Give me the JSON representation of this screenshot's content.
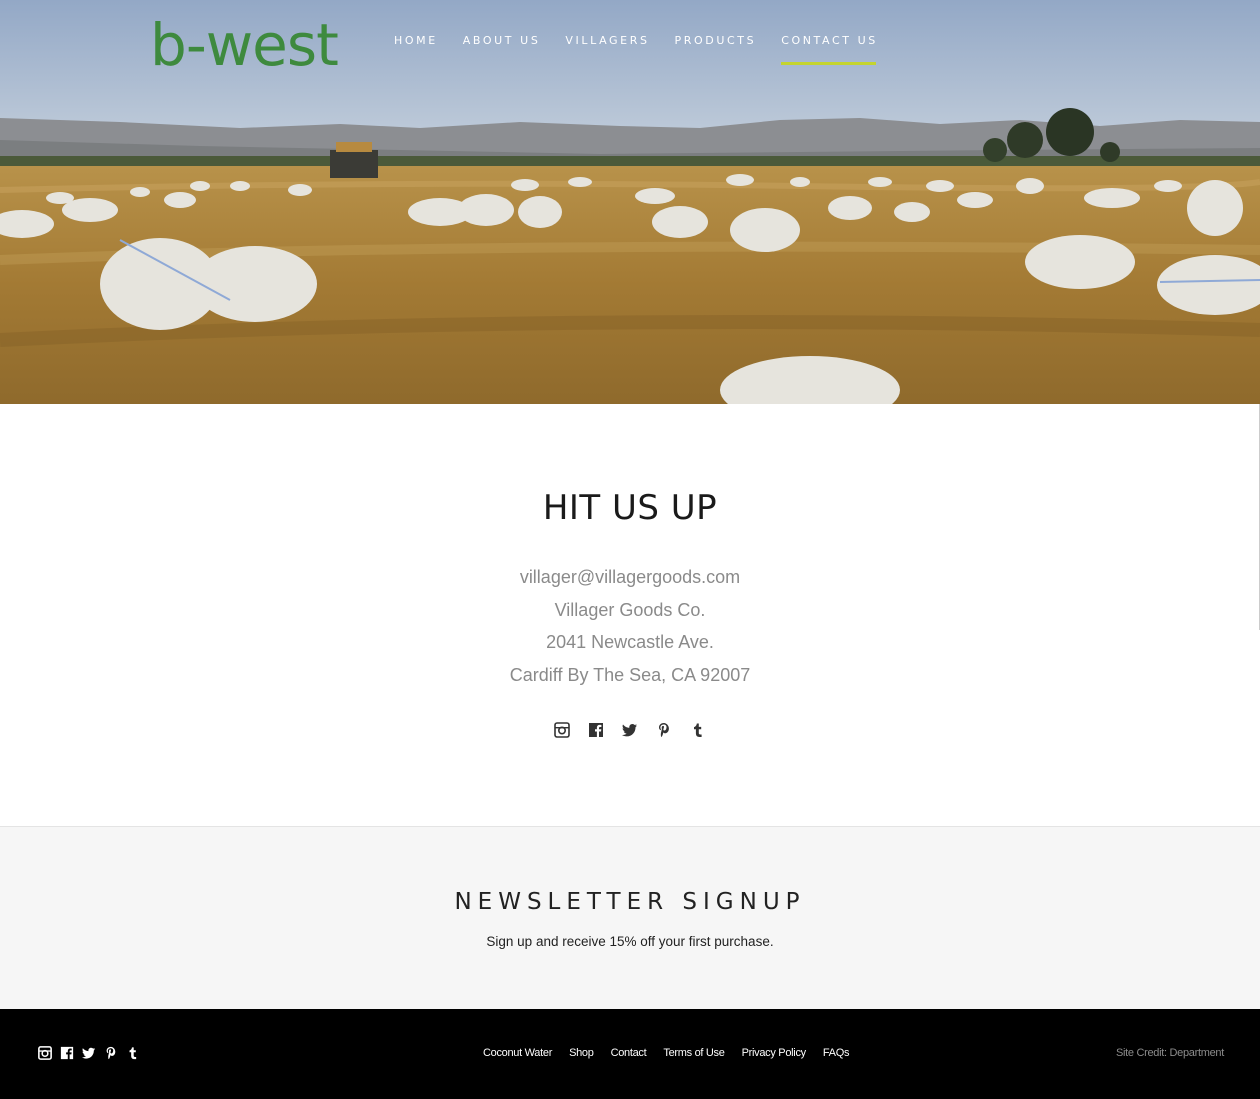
{
  "brand": {
    "logo_text": "b-west",
    "logo_color": "#3e8a3e"
  },
  "nav": {
    "items": [
      {
        "label": "HOME"
      },
      {
        "label": "ABOUT US"
      },
      {
        "label": "VILLAGERS"
      },
      {
        "label": "PRODUCTS"
      },
      {
        "label": "CONTACT US",
        "active": true
      }
    ],
    "active_underline_color": "#c4d42e"
  },
  "hero": {
    "image": "wheat field with white grain sacks, mountains and trees in background"
  },
  "contact": {
    "title": "HIT US UP",
    "email": "villager@villagergoods.com",
    "company": "Villager Goods Co.",
    "street": "2041 Newcastle Ave.",
    "city": "Cardiff By The Sea, CA 92007",
    "social_icons": [
      "instagram-icon",
      "facebook-icon",
      "twitter-icon",
      "pinterest-icon",
      "tumblr-icon"
    ]
  },
  "newsletter": {
    "title": "NEWSLETTER SIGNUP",
    "subtitle": "Sign up and receive 15% off your first purchase."
  },
  "footer": {
    "social_icons": [
      "instagram-icon",
      "facebook-icon",
      "twitter-icon",
      "pinterest-icon",
      "tumblr-icon"
    ],
    "links": [
      {
        "label": "Coconut Water"
      },
      {
        "label": "Shop"
      },
      {
        "label": "Contact"
      },
      {
        "label": "Terms of Use"
      },
      {
        "label": "Privacy Policy"
      },
      {
        "label": "FAQs"
      }
    ],
    "site_credit": "Site Credit: Department"
  },
  "colors": {
    "footer_bg": "#000000",
    "newsletter_bg": "#f6f6f6",
    "contact_text": "#8a8a8a"
  }
}
